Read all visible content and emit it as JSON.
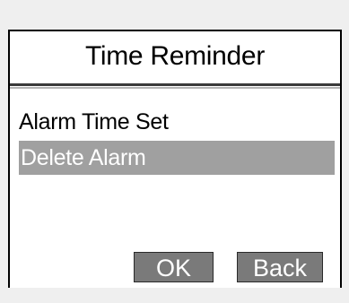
{
  "dialog": {
    "title": "Time Reminder",
    "menu_items": [
      {
        "label": "Alarm Time Set",
        "selected": false
      },
      {
        "label": "Delete Alarm",
        "selected": true
      }
    ],
    "ok_label": "OK",
    "back_label": "Back"
  },
  "colors": {
    "background": "#efefef",
    "panel": "#ffffff",
    "border": "#000000",
    "selection": "#a0a0a0",
    "button": "#7a7a7a",
    "button_text": "#ffffff"
  }
}
